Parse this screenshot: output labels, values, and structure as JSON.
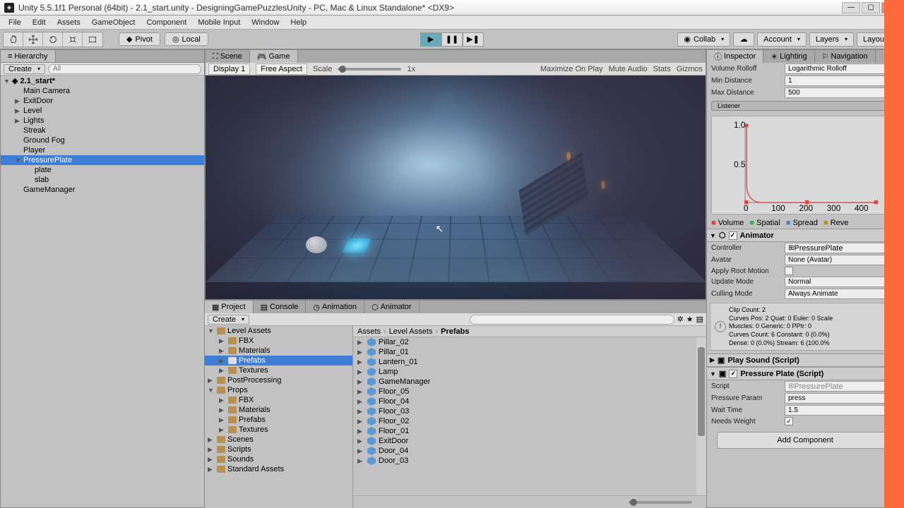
{
  "window": {
    "title": "Unity 5.5.1f1 Personal (64bit) - 2.1_start.unity - DesigningGamePuzzlesUnity - PC, Mac & Linux Standalone* <DX9>"
  },
  "menu": [
    "File",
    "Edit",
    "Assets",
    "GameObject",
    "Component",
    "Mobile Input",
    "Window",
    "Help"
  ],
  "toolbar": {
    "pivot": "Pivot",
    "local": "Local",
    "collab": "Collab",
    "account": "Account",
    "layers": "Layers",
    "layout": "Layout"
  },
  "hierarchy": {
    "title": "Hierarchy",
    "create": "Create",
    "search_placeholder": "All",
    "scene": "2.1_start*",
    "items": [
      {
        "name": "Main Camera",
        "indent": 1
      },
      {
        "name": "ExitDoor",
        "indent": 1,
        "fold": true
      },
      {
        "name": "Level",
        "indent": 1,
        "fold": true
      },
      {
        "name": "Lights",
        "indent": 1,
        "fold": true
      },
      {
        "name": "Streak",
        "indent": 1
      },
      {
        "name": "Ground Fog",
        "indent": 1
      },
      {
        "name": "Player",
        "indent": 1
      },
      {
        "name": "PressurePlate",
        "indent": 1,
        "fold": true,
        "open": true,
        "selected": true
      },
      {
        "name": "plate",
        "indent": 2
      },
      {
        "name": "slab",
        "indent": 2
      },
      {
        "name": "GameManager",
        "indent": 1
      }
    ]
  },
  "scene_tab": "Scene",
  "game_tab": "Game",
  "game_bar": {
    "display": "Display 1",
    "aspect": "Free Aspect",
    "scale_lbl": "Scale",
    "scale_val": "1x",
    "max": "Maximize On Play",
    "mute": "Mute Audio",
    "stats": "Stats",
    "gizmos": "Gizmos"
  },
  "project": {
    "tabs": [
      "Project",
      "Console",
      "Animation",
      "Animator"
    ],
    "create": "Create",
    "folders": [
      {
        "name": "Level Assets",
        "indent": 0,
        "open": true
      },
      {
        "name": "FBX",
        "indent": 1
      },
      {
        "name": "Materials",
        "indent": 1
      },
      {
        "name": "Prefabs",
        "indent": 1,
        "selected": true
      },
      {
        "name": "Textures",
        "indent": 1
      },
      {
        "name": "PostProcessing",
        "indent": 0
      },
      {
        "name": "Props",
        "indent": 0,
        "open": true
      },
      {
        "name": "FBX",
        "indent": 1
      },
      {
        "name": "Materials",
        "indent": 1
      },
      {
        "name": "Prefabs",
        "indent": 1
      },
      {
        "name": "Textures",
        "indent": 1
      },
      {
        "name": "Scenes",
        "indent": 0
      },
      {
        "name": "Scripts",
        "indent": 0
      },
      {
        "name": "Sounds",
        "indent": 0
      },
      {
        "name": "Standard Assets",
        "indent": 0
      }
    ],
    "breadcrumb": [
      "Assets",
      "Level Assets",
      "Prefabs"
    ],
    "assets": [
      "Door_03",
      "Door_04",
      "ExitDoor",
      "Floor_01",
      "Floor_02",
      "Floor_03",
      "Floor_04",
      "Floor_05",
      "GameManager",
      "Lamp",
      "Lantern_01",
      "Pillar_01",
      "Pillar_02"
    ]
  },
  "inspector": {
    "tabs": [
      "Inspector",
      "Lighting",
      "Navigation"
    ],
    "audio": {
      "rolloff_lbl": "Volume Rolloff",
      "rolloff_val": "Logarithmic Rolloff",
      "min_lbl": "Min Distance",
      "min_val": "1",
      "max_lbl": "Max Distance",
      "max_val": "500",
      "listener": "Listener",
      "axis": [
        "0",
        "100",
        "200",
        "300",
        "400"
      ],
      "legend": {
        "v": "Volume",
        "s": "Spatial",
        "sp": "Spread",
        "r": "Reve"
      }
    },
    "animator": {
      "title": "Animator",
      "controller_lbl": "Controller",
      "controller_val": "PressurePlate",
      "avatar_lbl": "Avatar",
      "avatar_val": "None (Avatar)",
      "root_lbl": "Apply Root Motion",
      "update_lbl": "Update Mode",
      "update_val": "Normal",
      "cull_lbl": "Culling Mode",
      "cull_val": "Always Animate",
      "info": "Clip Count: 2\nCurves Pos: 2 Quat: 0 Euler: 0 Scale\nMuscles: 0 Generic: 0 PPtr: 0\nCurves Count: 6 Constant: 0 (0.0%)\nDense: 0 (0.0%) Stream: 6 (100.0%"
    },
    "playsound": {
      "title": "Play Sound (Script)"
    },
    "pressure": {
      "title": "Pressure Plate (Script)",
      "script_lbl": "Script",
      "script_val": "PressurePlate",
      "param_lbl": "Pressure Param",
      "param_val": "press",
      "wait_lbl": "Wait Time",
      "wait_val": "1.5",
      "needs_lbl": "Needs Weight"
    },
    "add_component": "Add Component"
  }
}
